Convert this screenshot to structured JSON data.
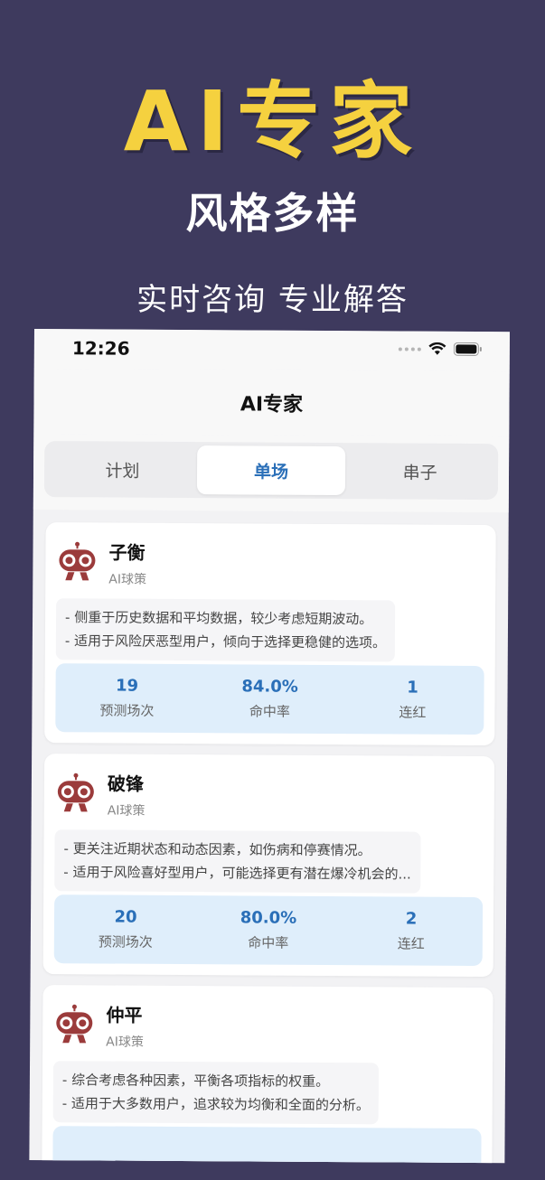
{
  "promo": {
    "title": "AI专家",
    "subtitle1": "风格多样",
    "subtitle2": "实时咨询 专业解答"
  },
  "status_bar": {
    "time": "12:26"
  },
  "nav": {
    "title": "AI专家"
  },
  "tabs": [
    {
      "label": "计划",
      "active": false
    },
    {
      "label": "单场",
      "active": true
    },
    {
      "label": "串子",
      "active": false
    }
  ],
  "experts": [
    {
      "name": "子衡",
      "tag": "AI球策",
      "desc": [
        "- 侧重于历史数据和平均数据，较少考虑短期波动。",
        "- 适用于风险厌恶型用户，倾向于选择更稳健的选项。"
      ],
      "stats": [
        {
          "value": "19",
          "label": "预测场次"
        },
        {
          "value": "84.0%",
          "label": "命中率"
        },
        {
          "value": "1",
          "label": "连红"
        }
      ]
    },
    {
      "name": "破锋",
      "tag": "AI球策",
      "desc": [
        "- 更关注近期状态和动态因素，如伤病和停赛情况。",
        "- 适用于风险喜好型用户，可能选择更有潜在爆冷机会的..."
      ],
      "stats": [
        {
          "value": "20",
          "label": "预测场次"
        },
        {
          "value": "80.0%",
          "label": "命中率"
        },
        {
          "value": "2",
          "label": "连红"
        }
      ]
    },
    {
      "name": "仲平",
      "tag": "AI球策",
      "desc": [
        "- 综合考虑各种因素，平衡各项指标的权重。",
        "- 适用于大多数用户，追求较为均衡和全面的分析。"
      ],
      "stats": []
    }
  ],
  "colors": {
    "background": "#3e3a5e",
    "promo_title": "#f5d13f",
    "accent": "#2a6fb8",
    "stats_bg": "#dfeefb"
  }
}
